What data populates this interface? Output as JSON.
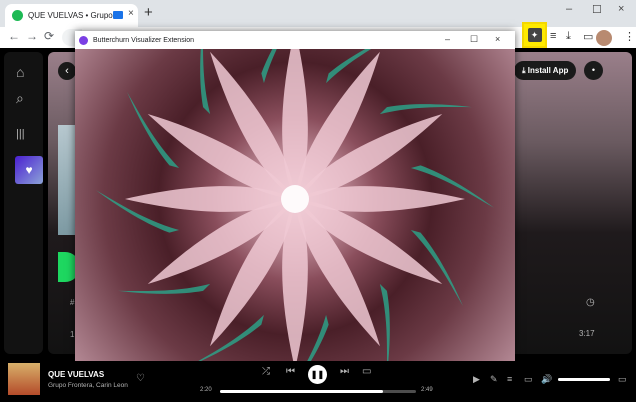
{
  "browser": {
    "tab_title": "QUE VUELVAS • Grupo Fron",
    "tab_close": "×",
    "new_tab": "+",
    "window_controls": [
      "–",
      "☐",
      "×"
    ],
    "nav": [
      "←",
      "→",
      "⟳"
    ],
    "toolbar_icons": [
      "≡",
      "⤓",
      "▭",
      "⋮"
    ],
    "extension_icon": "puzzle-icon"
  },
  "visualizer": {
    "window_title": "Butterchurn Visualizer Extension",
    "window_controls": [
      "–",
      "☐",
      "×"
    ]
  },
  "spotify": {
    "sidebar_icons": [
      "⌂",
      "⌕",
      "|||"
    ],
    "liked_icon": "♥",
    "back": "‹",
    "install_app": "⤓ Install App",
    "bell": "🔔",
    "header_hash": "#",
    "row_index": "1",
    "clock": "◷",
    "duration": "3:17"
  },
  "player": {
    "title": "QUE VUELVAS",
    "artist": "Grupo Frontera, Carin Leon",
    "heart": "♡",
    "shuffle": "⤮",
    "prev": "⏮",
    "play_pause": "❚❚",
    "next": "⏭",
    "lyrics": "▭",
    "elapsed": "2:20",
    "total": "2:49",
    "progress_fraction": 0.83,
    "right_icons": [
      "▶",
      "✎",
      "≡",
      "▭",
      "🔊"
    ],
    "volume_fraction": 1.0,
    "miniplayer": "▭"
  }
}
